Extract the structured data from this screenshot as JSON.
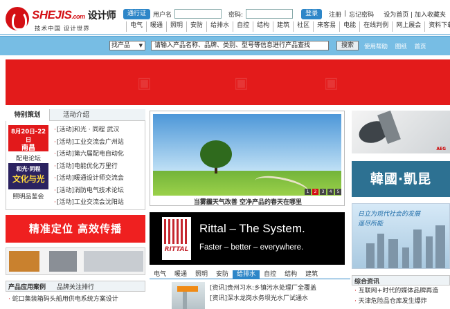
{
  "header": {
    "logo_brand": "SHEJIS",
    "logo_domain": ".com",
    "logo_cn": "设计师",
    "logo_tagline": "技术中国  设计世界",
    "pass_label": "通行证",
    "username_label": "用户名",
    "password_label": "密码:",
    "login_button": "登录",
    "register_link": "注册",
    "forgot_link": "忘记密码",
    "home_link": "设为首页",
    "fav_link": "加入收藏夹"
  },
  "nav": [
    "电气",
    "暖通",
    "照明",
    "安防",
    "给排水",
    "自控",
    "结构",
    "建筑",
    "社区",
    "来客易",
    "电能",
    "在线判例",
    "网上展会",
    "资料下载"
  ],
  "search": {
    "category": "找产品",
    "placeholder": "请输入产品名称、品牌、类别、型号等信息进行产品查找",
    "button": "搜索",
    "links": [
      "使用帮助",
      "图纸",
      "首页"
    ]
  },
  "left": {
    "tab_active": "特别策划",
    "tab_other": "活动介绍",
    "promo1_date": "8月20日-22日",
    "promo1_city": "南昌",
    "promo1_caption": "配电论坛",
    "promo2_top": "和光·同程",
    "promo2_main": "文化与光",
    "promo2_caption": "照明品鉴会",
    "events": [
      "[活动]和光 · 同程  武汉",
      "[活动]工业交流会广州站",
      "[活动]第六届配电自动化",
      "[活动]电能优化万里行",
      "[活动]暖通设计师交流会",
      "[活动]消防电气技术论坛",
      "[活动]工业交流会沈阳站"
    ],
    "ad_text": "精准定位  高效传播",
    "prod_tab_active": "产品应用案例",
    "prod_tab_other": "品牌关注排行",
    "prod_items": [
      "蛇口集装箱码头船用供电系统方案设计"
    ]
  },
  "center": {
    "photo_caption": "当雾霾天气改善  空净产品的春天在哪里",
    "pager": [
      "1",
      "2",
      "3",
      "4",
      "5"
    ],
    "rittal_title": "Rittal – The System.",
    "rittal_tagline": "Faster – better – everywhere.",
    "rittal_logo": "RITTAL",
    "nav2": [
      "电气",
      "暖通",
      "照明",
      "安防",
      "给排水",
      "自控",
      "结构",
      "建筑"
    ],
    "news": [
      "[资讯]贵州习水:乡镇污水处理厂全覆盖",
      "[资讯]深水龙岗水务坝光水厂试通水"
    ]
  },
  "right": {
    "aeg_label": "AEG",
    "korea_text": "韓國·凱昆",
    "city_line1": "日立为现代社会的发展",
    "city_line2": "遥尽所能",
    "zx_title": "综合资讯",
    "zx_items": [
      "互联网+时代的媒体品牌再造",
      "天津危险品仓库发生爆炸"
    ]
  }
}
